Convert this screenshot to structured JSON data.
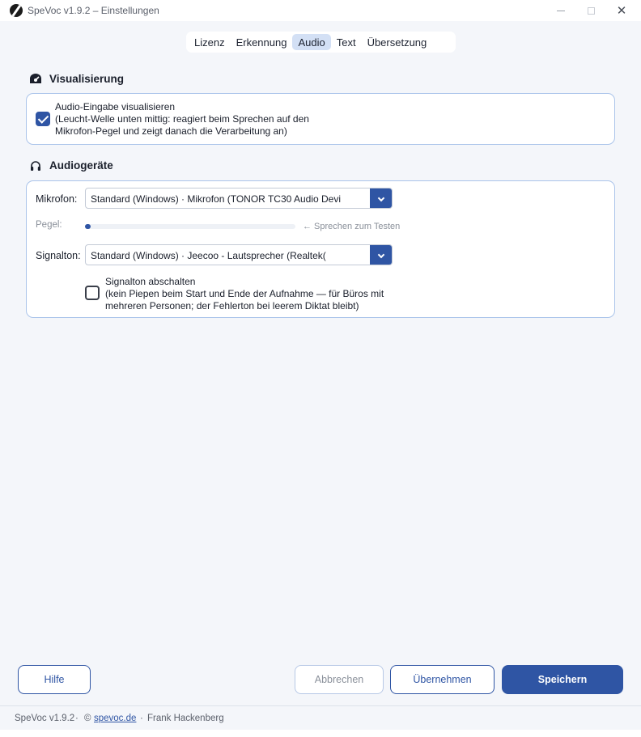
{
  "window": {
    "title": "SpeVoc v1.9.2 – Einstellungen",
    "min_glyph": "—",
    "max_glyph": "☐",
    "close_glyph": "✕"
  },
  "tabs": [
    {
      "label": "Lizenz",
      "active": false
    },
    {
      "label": "Erkennung",
      "active": false
    },
    {
      "label": "Audio",
      "active": true
    },
    {
      "label": "Text",
      "active": false
    },
    {
      "label": "Übersetzung",
      "active": false
    }
  ],
  "visualisierung": {
    "heading": "Visualisierung",
    "icon": "gauge-icon",
    "checkbox": {
      "checked": true,
      "line1": "Audio-Eingabe visualisieren",
      "line2": "(Leucht-Welle unten mittig: reagiert beim Sprechen auf den",
      "line3": "Mikrofon-Pegel und zeigt danach die Verarbeitung an)"
    }
  },
  "audiogeraete": {
    "heading": "Audiogeräte",
    "icon": "headphones-icon",
    "mikrofon": {
      "label": "Mikrofon:",
      "value": "Standard (Windows)  ·  Mikrofon (TONOR TC30 Audio Devi"
    },
    "pegel": {
      "label": "Pegel:",
      "level_percent": 2,
      "hint": "← Sprechen zum Testen"
    },
    "signalton": {
      "label": "Signalton:",
      "value": "Standard (Windows)  ·  Jeecoo - Lautsprecher (Realtek("
    },
    "signalton_checkbox": {
      "checked": false,
      "line1": "Signalton abschalten",
      "line2": "(kein Piepen beim Start und Ende der Aufnahme — für Büros mit",
      "line3": "mehreren Personen; der Fehlerton bei leerem Diktat bleibt)"
    }
  },
  "buttons": {
    "help": "Hilfe",
    "cancel": "Abbrechen",
    "apply": "Übernehmen",
    "save": "Speichern"
  },
  "status": {
    "version": "SpeVoc v1.9.2",
    "sep1": "·",
    "copyright": "©",
    "link": "spevoc.de",
    "sep2": "·",
    "author": "Frank Hackenberg"
  },
  "colors": {
    "accent": "#2f55a4",
    "card_border": "#aac4ea",
    "active_tab": "#d3e0f5"
  }
}
